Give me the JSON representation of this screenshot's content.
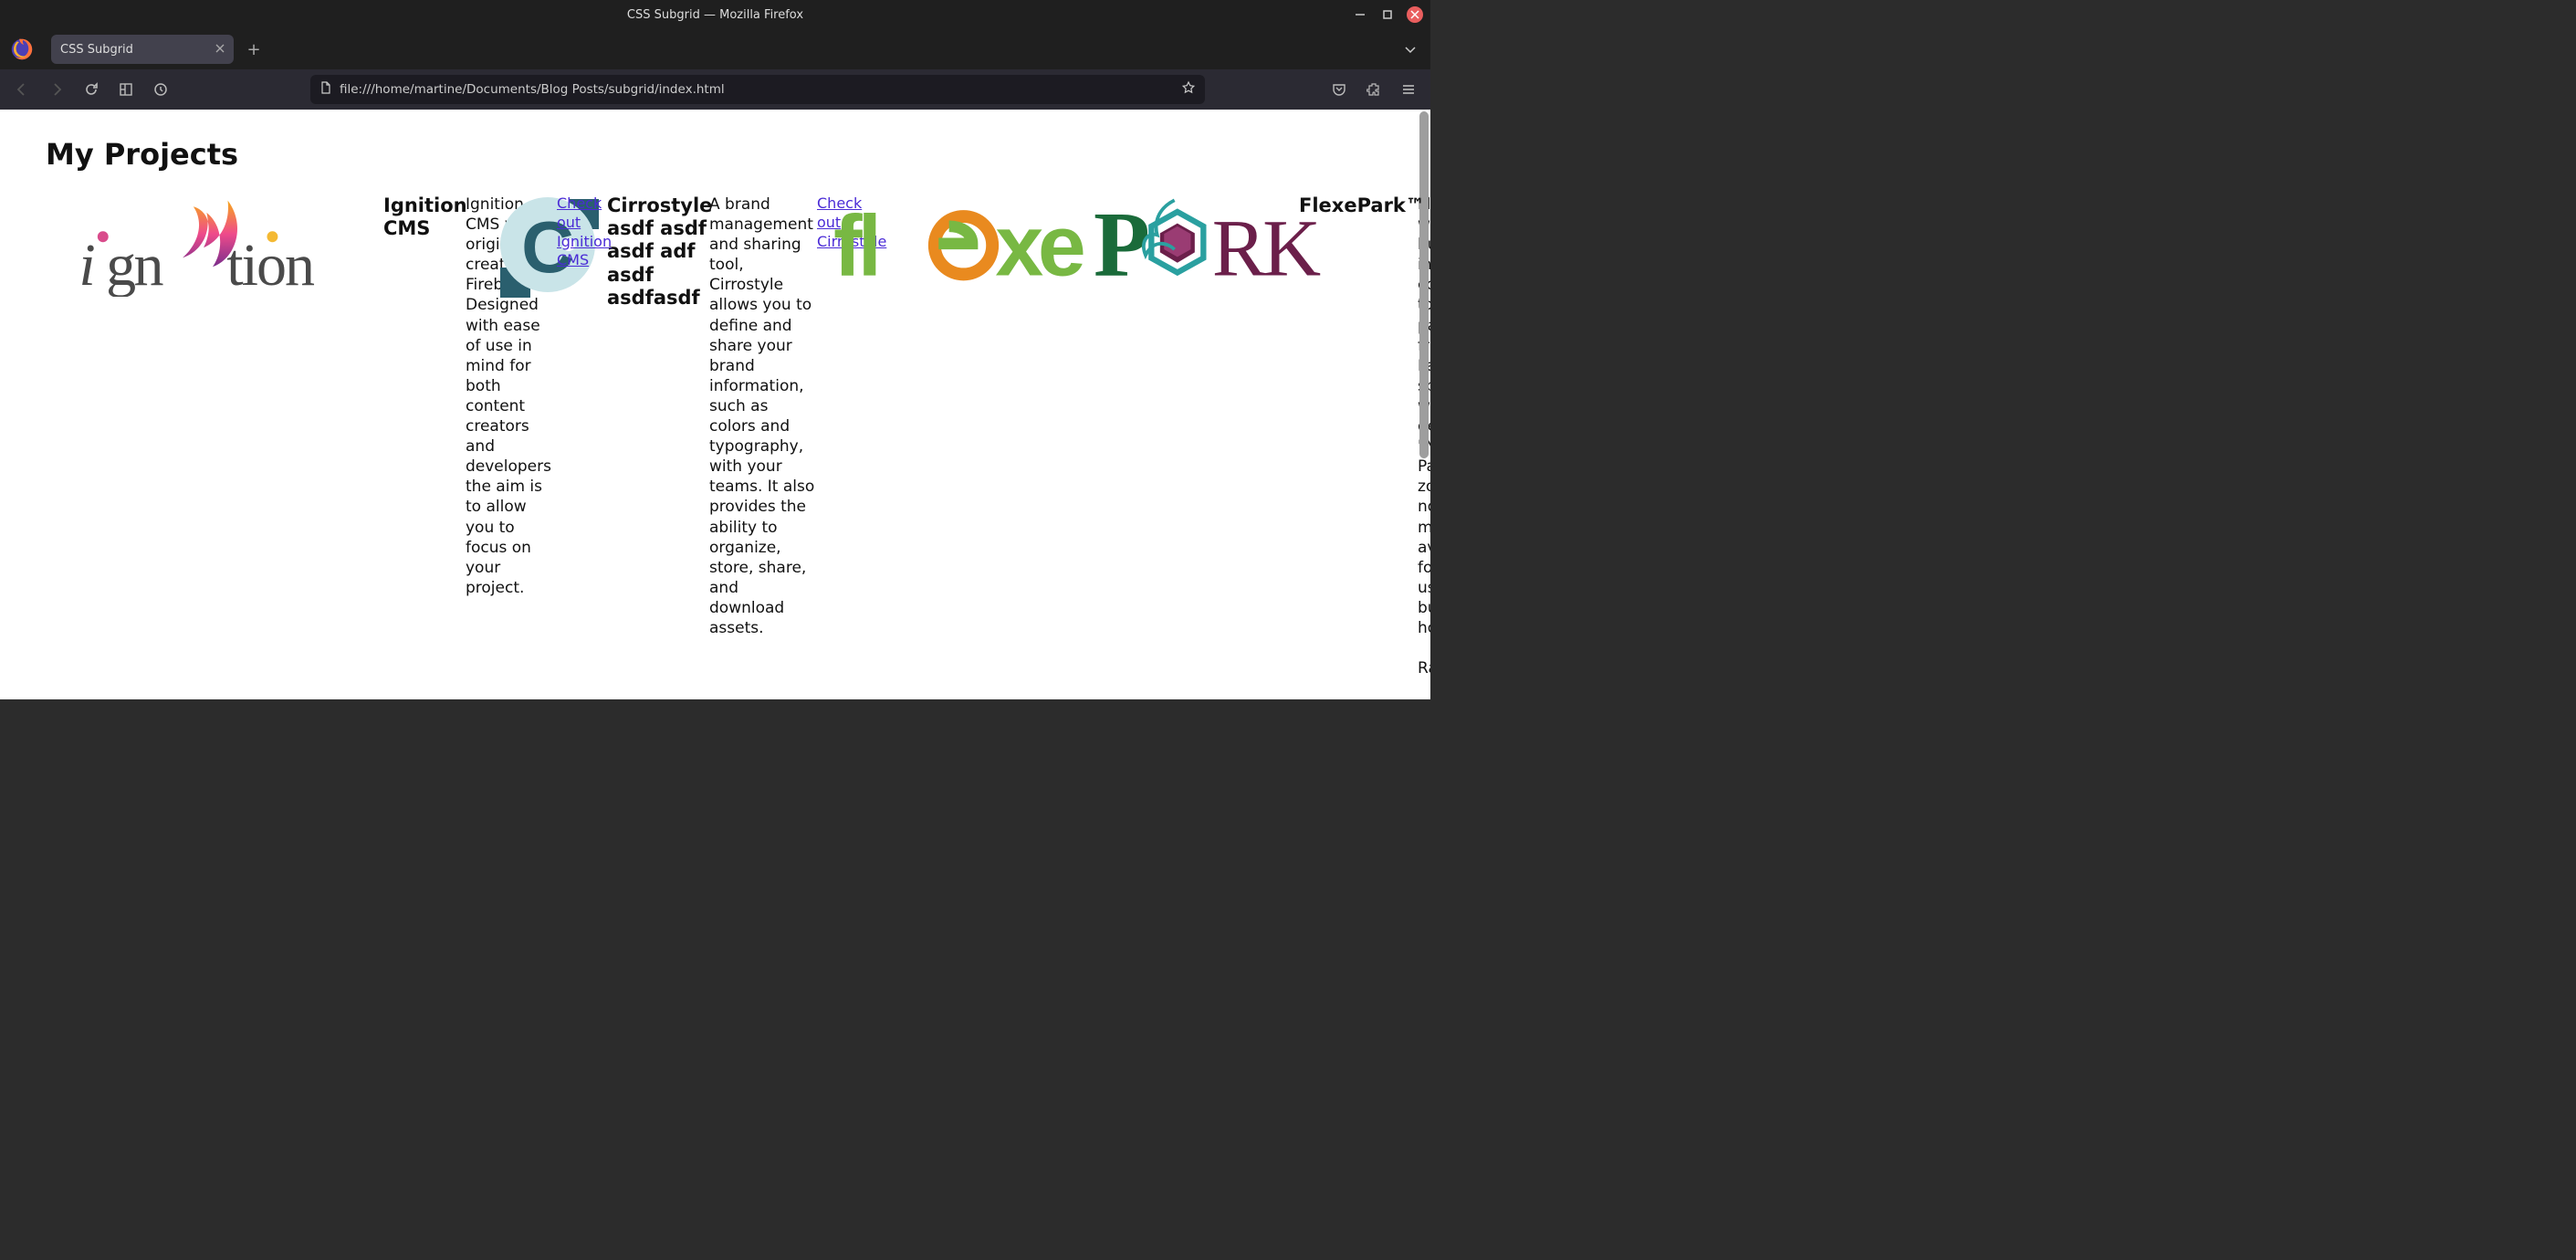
{
  "window": {
    "title": "CSS Subgrid — Mozilla Firefox"
  },
  "tabs": [
    {
      "label": "CSS Subgrid"
    }
  ],
  "address_bar": {
    "url": "file:///home/martine/Documents/Blog Posts/subgrid/index.html"
  },
  "page": {
    "heading": "My Projects",
    "projects": [
      {
        "title": "Ignition CMS",
        "description": "Ignition CMS was originally created for Firebase. Designed with ease of use in mind for both content creators and developers the aim is to allow you to focus on your project.",
        "link_text": "Check out Ignition CMS"
      },
      {
        "title": "Cirrostyle asdf asdf asdf adf asdf asdfasdf",
        "description": "A brand management and sharing tool, Cirrostyle allows you to define and share your brand information, such as colors and typography, with your teams. It also provides the ability to organize, store, share, and download assets.",
        "link_text": "Check out Cirrostyle"
      },
      {
        "title": "FlexePark™",
        "description": "FlexePark works with businesses in your community to make parking friendlier! Parking spots that were once designated \"No Parking\" zones can now be made available for public use after business hours.\n\nRather",
        "link_text": ""
      }
    ]
  }
}
